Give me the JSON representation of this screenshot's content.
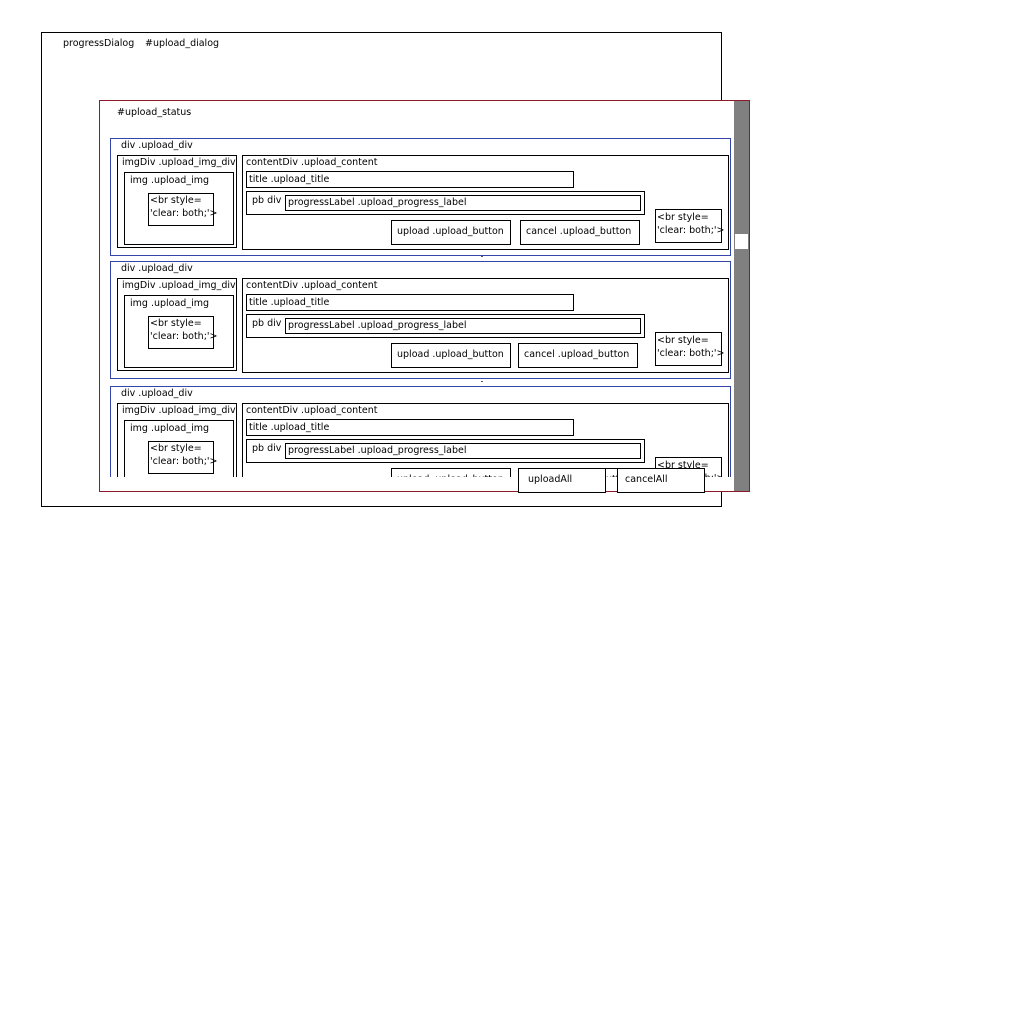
{
  "dialog": {
    "title": "progressDialog",
    "id_label": "#upload_dialog"
  },
  "status": {
    "label": "#upload_status"
  },
  "upload_item": {
    "div_label": "div .upload_div",
    "img_div_label": "imgDiv .upload_img_div",
    "img_label": "img .upload_img",
    "br_label_1": "<br style=",
    "br_label_2": "'clear: both;'>",
    "content_label": "contentDiv .upload_content",
    "title_label": "title .upload_title",
    "pb_label": "pb div",
    "progress_label": "progressLabel .upload_progress_label",
    "upload_button": "upload .upload_button",
    "cancel_button": "cancel .upload_button"
  },
  "footer": {
    "upload_all": "uploadAll",
    "cancel_all": "cancelAll"
  }
}
